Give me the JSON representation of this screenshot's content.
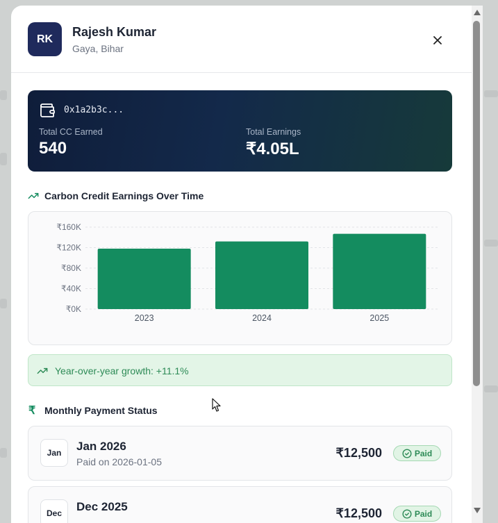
{
  "profile": {
    "initials": "RK",
    "name": "Rajesh Kumar",
    "location": "Gaya, Bihar"
  },
  "wallet": {
    "address": "0x1a2b3c...",
    "cc_label": "Total CC Earned",
    "cc_value": "540",
    "earnings_label": "Total Earnings",
    "earnings_value": "₹4.05L"
  },
  "chart_section": {
    "title": "Carbon Credit Earnings Over Time"
  },
  "chart_data": {
    "type": "bar",
    "categories": [
      "2023",
      "2024",
      "2025"
    ],
    "values": [
      118000,
      132000,
      147000
    ],
    "yticks": [
      "₹0K",
      "₹40K",
      "₹80K",
      "₹120K",
      "₹160K"
    ],
    "ytick_values": [
      0,
      40000,
      80000,
      120000,
      160000
    ],
    "ylim": [
      0,
      160000
    ],
    "bar_color": "#148c5f",
    "grid": true,
    "title": "",
    "xlabel": "",
    "ylabel": ""
  },
  "growth": {
    "text": "Year-over-year growth: +11.1%"
  },
  "payments_section": {
    "title": "Monthly Payment Status",
    "items": [
      {
        "badge": "Jan",
        "title": "Jan 2026",
        "subtitle": "Paid on 2026-01-05",
        "amount": "₹12,500",
        "status": "Paid"
      },
      {
        "badge": "Dec",
        "title": "Dec 2025",
        "subtitle": "",
        "amount": "₹12,500",
        "status": "Paid"
      }
    ]
  },
  "colors": {
    "accent": "#148c5f",
    "avatar_bg": "#1f2a5c",
    "success_text": "#2e8b57"
  },
  "icons": {
    "close": "close-icon",
    "wallet": "wallet-icon",
    "trend": "trending-up-icon",
    "rupee": "rupee-icon",
    "paid": "check-circle-icon"
  }
}
